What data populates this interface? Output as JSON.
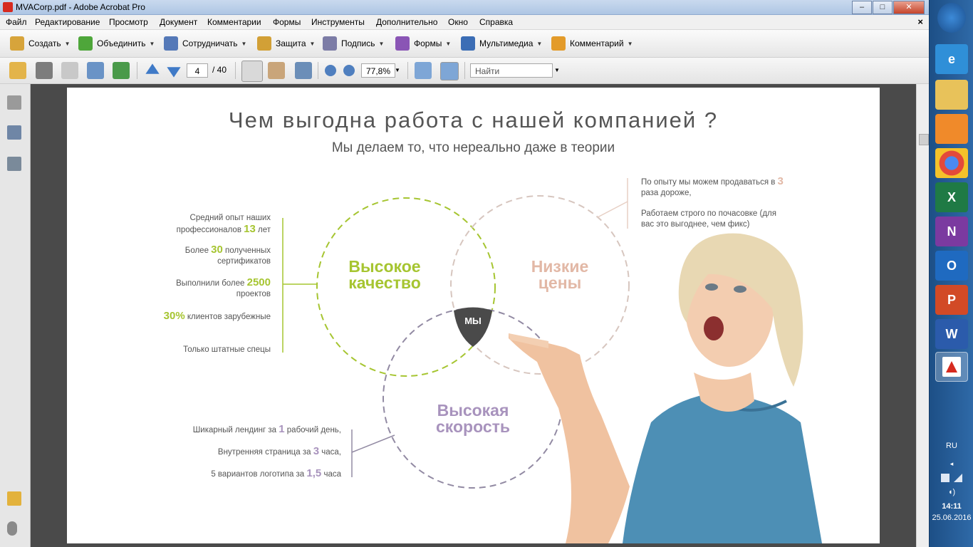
{
  "window": {
    "title": "MVACorp.pdf - Adobe Acrobat Pro",
    "buttons": [
      "–",
      "□",
      "✕"
    ]
  },
  "menu": {
    "items": [
      "Файл",
      "Редактирование",
      "Просмотр",
      "Документ",
      "Комментарии",
      "Формы",
      "Инструменты",
      "Дополнительно",
      "Окно",
      "Справка"
    ],
    "close": "×"
  },
  "toolbar1": {
    "items": [
      {
        "label": "Создать",
        "icon": "create-icon",
        "color": "#d7a43b"
      },
      {
        "label": "Объединить",
        "icon": "combine-icon",
        "color": "#4ea63a"
      },
      {
        "label": "Сотрудничать",
        "icon": "collaborate-icon",
        "color": "#5579b8"
      },
      {
        "label": "Защита",
        "icon": "lock-icon",
        "color": "#d2a036"
      },
      {
        "label": "Подпись",
        "icon": "pen-icon",
        "color": "#7c7ca6"
      },
      {
        "label": "Формы",
        "icon": "forms-icon",
        "color": "#8a55b5"
      },
      {
        "label": "Мультимедиа",
        "icon": "multimedia-icon",
        "color": "#3b6db5"
      },
      {
        "label": "Комментарий",
        "icon": "comment-icon",
        "color": "#e39b2a"
      }
    ],
    "dropdown_glyph": "▼"
  },
  "toolbar2": {
    "page_current": "4",
    "page_total": "/ 40",
    "zoom": "77,8%",
    "search_placeholder": "Найти"
  },
  "page": {
    "title": "Чем выгодна работа с нашей компанией ?",
    "subtitle": "Мы делаем то, что нереально даже в теории",
    "circles": {
      "quality": "Высокое качество",
      "price": "Низкие цены",
      "speed": "Высокая скорость",
      "center": "МЫ"
    },
    "quality_facts": [
      {
        "pre": "Средний опыт наших профессионалов ",
        "num": "13",
        "post": " лет"
      },
      {
        "pre": "Более ",
        "num": "30",
        "post": " полученных сертификатов"
      },
      {
        "pre": "Выполнили более ",
        "num": "2500",
        "post": " проектов"
      },
      {
        "pre": "",
        "num": "30%",
        "post": " клиентов зарубежные"
      },
      {
        "pre": "Только штатные спецы",
        "num": "",
        "post": ""
      }
    ],
    "price_facts": [
      {
        "pre": "По опыту мы можем продаваться в ",
        "num": "3",
        "post": " раза дороже,"
      },
      {
        "pre": "Работаем строго по почасовке (для вас это выгоднее, чем фикс)",
        "num": "",
        "post": ""
      }
    ],
    "speed_facts": [
      {
        "pre": "Шикарный лендинг за ",
        "num": "1",
        "post": " рабочий день,"
      },
      {
        "pre": "Внутренняя страница за ",
        "num": "3",
        "post": " часа,"
      },
      {
        "pre": "5 вариантов логотипа за ",
        "num": "1,5",
        "post": " часа"
      }
    ]
  },
  "taskbar": {
    "apps": [
      {
        "icon": "windows-start-icon",
        "label": ""
      },
      {
        "icon": "ie-icon",
        "label": "e"
      },
      {
        "icon": "explorer-icon",
        "label": ""
      },
      {
        "icon": "media-player-icon",
        "label": ""
      },
      {
        "icon": "chrome-icon",
        "label": ""
      },
      {
        "icon": "excel-icon",
        "label": "X"
      },
      {
        "icon": "onenote-icon",
        "label": "N"
      },
      {
        "icon": "outlook-icon",
        "label": "O"
      },
      {
        "icon": "powerpoint-icon",
        "label": "P"
      },
      {
        "icon": "word-icon",
        "label": "W"
      },
      {
        "icon": "acrobat-icon",
        "label": ""
      }
    ],
    "lang": "RU",
    "time": "14:11",
    "date": "25.06.2016"
  },
  "colors": {
    "green": "#a6c531",
    "peach": "#e2b8a6",
    "violet": "#a893bd",
    "center": "#4a4a4a"
  }
}
